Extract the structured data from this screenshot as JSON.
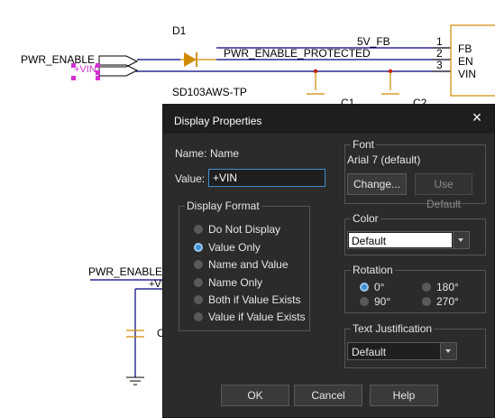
{
  "schematic": {
    "designator": "D1",
    "part_number": "SD103AWS-TP",
    "net_pwr_enable": "PWR_ENABLE",
    "net_pwr_enable_protected": "PWR_ENABLE_PROTECTED",
    "net_vin_top": "+VIN",
    "net_5v_fb": "5V_FB",
    "pin_1": "1",
    "pin_2": "2",
    "pin_3": "3",
    "pin_fb": "FB",
    "pin_en": "EN",
    "pin_vin": "VIN",
    "cap_c1": "C1",
    "cap_c2": "C2",
    "net_pwr_enable_lower": "PWR_ENABLE",
    "net_vin_lower": "+VI",
    "cap_partial": "C"
  },
  "dialog": {
    "title": "Display Properties",
    "close_label": "×",
    "name_label": "Name:",
    "name_value": "Name",
    "value_label": "Value:",
    "value_text": "+VIN",
    "display_format": {
      "legend": "Display Format",
      "options": [
        {
          "label": "Do Not Display",
          "selected": false
        },
        {
          "label": "Value Only",
          "selected": true
        },
        {
          "label": "Name and Value",
          "selected": false
        },
        {
          "label": "Name Only",
          "selected": false
        },
        {
          "label": "Both if Value Exists",
          "selected": false
        },
        {
          "label": "Value if Value Exists",
          "selected": false
        }
      ]
    },
    "font": {
      "legend": "Font",
      "current": "Arial 7 (default)",
      "change_button": "Change...",
      "use_default_button": "Use Default"
    },
    "color": {
      "legend": "Color",
      "selected": "Default"
    },
    "rotation": {
      "legend": "Rotation",
      "options": [
        {
          "label": "0°",
          "selected": true
        },
        {
          "label": "180°",
          "selected": false
        },
        {
          "label": "90°",
          "selected": false
        },
        {
          "label": "270°",
          "selected": false
        }
      ]
    },
    "text_justification": {
      "legend": "Text Justification",
      "selected": "Default"
    },
    "ok_button": "OK",
    "cancel_button": "Cancel",
    "help_button": "Help"
  },
  "colors": {
    "accent": "#3d8fd1",
    "dialog_bg": "#2b2b2b",
    "titlebar_bg": "#1e1e1e",
    "wire": "#00007f",
    "junction": "#c00000",
    "selection": "#d22fd2",
    "component": "#d08a00"
  }
}
